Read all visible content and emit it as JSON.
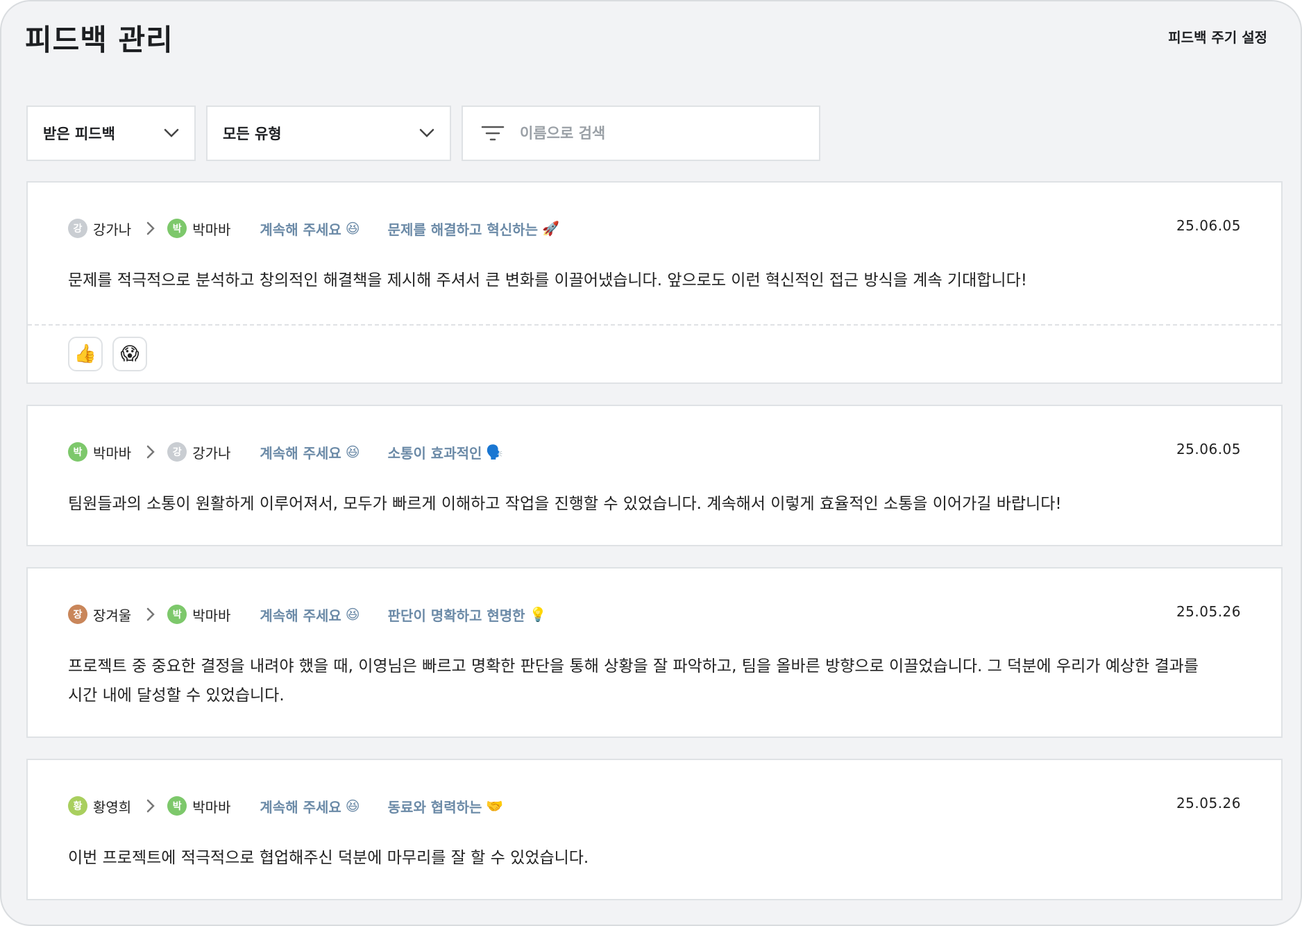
{
  "header": {
    "title": "피드백 관리",
    "cycle_settings": "피드백 주기 설정"
  },
  "filters": {
    "scope": "받은 피드백",
    "type": "모든 유형",
    "search_placeholder": "이름으로 검색"
  },
  "feedbacks": [
    {
      "from": {
        "name": "강가나",
        "initial": "강",
        "color": "#c9cdd2"
      },
      "to": {
        "name": "박마바",
        "initial": "박",
        "color": "#7dc86b"
      },
      "tag1": {
        "label": "계속해 주세요",
        "emoji": "😆"
      },
      "tag2": {
        "label": "문제를 해결하고 혁신하는",
        "emoji": "🚀"
      },
      "date": "25.06.05",
      "text": "문제를 적극적으로 분석하고 창의적인 해결책을 제시해 주셔서 큰 변화를 이끌어냈습니다. 앞으로도 이런 혁신적인 접근 방식을 계속 기대합니다!",
      "reactions": [
        "👍",
        "😱"
      ]
    },
    {
      "from": {
        "name": "박마바",
        "initial": "박",
        "color": "#7dc86b"
      },
      "to": {
        "name": "강가나",
        "initial": "강",
        "color": "#c9cdd2"
      },
      "tag1": {
        "label": "계속해 주세요",
        "emoji": "😆"
      },
      "tag2": {
        "label": "소통이 효과적인",
        "emoji": "🗣️"
      },
      "date": "25.06.05",
      "text": "팀원들과의 소통이 원활하게 이루어져서, 모두가 빠르게 이해하고 작업을 진행할 수 있었습니다. 계속해서 이렇게 효율적인 소통을 이어가길 바랍니다!"
    },
    {
      "from": {
        "name": "장겨울",
        "initial": "장",
        "color": "#c9865a"
      },
      "to": {
        "name": "박마바",
        "initial": "박",
        "color": "#7dc86b"
      },
      "tag1": {
        "label": "계속해 주세요",
        "emoji": "😆"
      },
      "tag2": {
        "label": "판단이 명확하고 현명한",
        "emoji": "💡"
      },
      "date": "25.05.26",
      "text": "프로젝트 중 중요한 결정을 내려야 했을 때, 이영님은 빠르고 명확한 판단을 통해 상황을 잘 파악하고, 팀을 올바른 방향으로 이끌었습니다. 그 덕분에 우리가 예상한 결과를 시간 내에 달성할 수 있었습니다."
    },
    {
      "from": {
        "name": "황영희",
        "initial": "황",
        "color": "#a9cf5e"
      },
      "to": {
        "name": "박마바",
        "initial": "박",
        "color": "#7dc86b"
      },
      "tag1": {
        "label": "계속해 주세요",
        "emoji": "😆"
      },
      "tag2": {
        "label": "동료와 협력하는",
        "emoji": "🤝"
      },
      "date": "25.05.26",
      "text": "이번 프로젝트에 적극적으로 협업해주신 덕분에 마무리를 잘 할 수 있었습니다."
    }
  ]
}
